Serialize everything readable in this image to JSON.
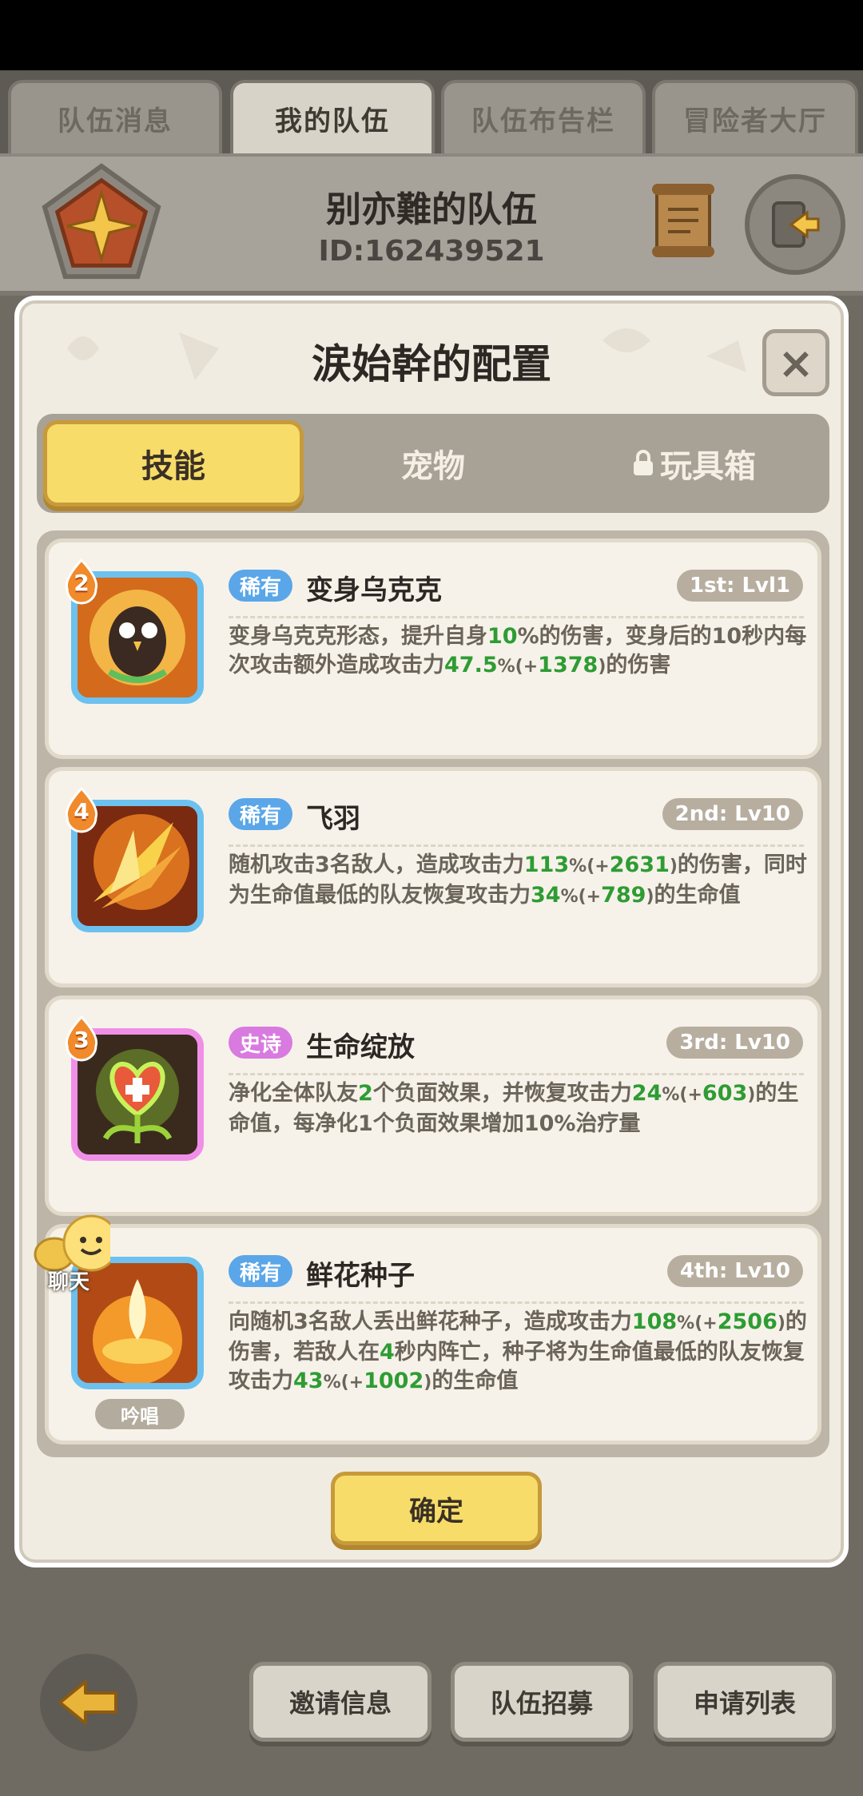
{
  "top_tabs": [
    "队伍消息",
    "我的队伍",
    "队伍布告栏",
    "冒险者大厅"
  ],
  "team": {
    "name": "别亦難的队伍",
    "id_text": "ID:162439521"
  },
  "modal": {
    "title": "涙始幹的配置",
    "close_label": "×",
    "tabs": {
      "skills": "技能",
      "pets": "宠物",
      "toybox": "玩具箱"
    },
    "confirm_label": "确定"
  },
  "skills": [
    {
      "rank": "2",
      "rarity": "稀有",
      "rarity_kind": "rare",
      "name": "变身乌克克",
      "slot": "1st: Lvl1",
      "desc": [
        {
          "t": "变身乌克克形态，提升自身"
        },
        {
          "t": "10",
          "g": true
        },
        {
          "t": "%的伤害，变身后的10秒内每次攻击额外造成攻击力"
        },
        {
          "t": "47.5",
          "g": true
        },
        {
          "t": "%(+",
          "s": true
        },
        {
          "t": "1378",
          "g": true
        },
        {
          "t": ")",
          "s": true
        },
        {
          "t": "的伤害"
        }
      ]
    },
    {
      "rank": "4",
      "rarity": "稀有",
      "rarity_kind": "rare",
      "name": "飞羽",
      "slot": "2nd: Lv10",
      "desc": [
        {
          "t": "随机攻击3名敌人，造成攻击力"
        },
        {
          "t": "113",
          "g": true
        },
        {
          "t": "%(+",
          "s": true
        },
        {
          "t": "2631",
          "g": true
        },
        {
          "t": ")",
          "s": true
        },
        {
          "t": "的伤害，同时为生命值最低的队友恢复攻击力"
        },
        {
          "t": "34",
          "g": true
        },
        {
          "t": "%(+",
          "s": true
        },
        {
          "t": "789",
          "g": true
        },
        {
          "t": ")",
          "s": true
        },
        {
          "t": "的生命值"
        }
      ]
    },
    {
      "rank": "3",
      "rarity": "史诗",
      "rarity_kind": "epic",
      "name": "生命绽放",
      "slot": "3rd: Lv10",
      "desc": [
        {
          "t": "净化全体队友"
        },
        {
          "t": "2",
          "g": true
        },
        {
          "t": "个负面效果，并恢复攻击力"
        },
        {
          "t": "24",
          "g": true
        },
        {
          "t": "%(+",
          "s": true
        },
        {
          "t": "603",
          "g": true
        },
        {
          "t": ")",
          "s": true
        },
        {
          "t": "的生命值，每净化1个负面效果增加10%治疗量"
        }
      ]
    },
    {
      "rank": "",
      "rarity": "稀有",
      "rarity_kind": "rare",
      "name": "鲜花种子",
      "slot": "4th: Lv10",
      "chant": "吟唱",
      "desc": [
        {
          "t": "向随机3名敌人丢出鲜花种子，造成攻击力"
        },
        {
          "t": "108",
          "g": true
        },
        {
          "t": "%(+",
          "s": true
        },
        {
          "t": "2506",
          "g": true
        },
        {
          "t": ")",
          "s": true
        },
        {
          "t": "的伤害，若敌人在"
        },
        {
          "t": "4",
          "g": true
        },
        {
          "t": "秒内阵亡，种子将为生命值最低的队友恢复攻击力"
        },
        {
          "t": "43",
          "g": true
        },
        {
          "t": "%(+",
          "s": true
        },
        {
          "t": "1002",
          "g": true
        },
        {
          "t": ")",
          "s": true
        },
        {
          "t": "的生命值"
        }
      ]
    }
  ],
  "chat_label": "聊天",
  "bottom_buttons": [
    "邀请信息",
    "队伍招募",
    "申请列表"
  ],
  "colors": {
    "accent_yellow": "#f7dc6a",
    "rare_blue": "#5aa6e8",
    "epic_pink": "#d87ae0",
    "value_green": "#2e9c33"
  },
  "icons": [
    "guild-emblem-icon",
    "scroll-icon",
    "exit-icon",
    "close-icon",
    "lock-icon",
    "chat-icon",
    "back-arrow-icon"
  ]
}
